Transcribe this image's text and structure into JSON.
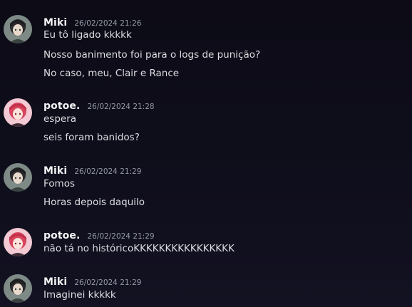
{
  "channel": {
    "messages": [
      {
        "author": "Miki",
        "avatar": "miki-avatar",
        "timestamp": "26/02/2024 21:26",
        "lines": [
          "Eu tô ligado kkkkk",
          "Nosso banimento foi para o logs de punição?",
          "No caso, meu, Clair e Rance"
        ]
      },
      {
        "author": "potoe.",
        "avatar": "potoe-avatar",
        "timestamp": "26/02/2024 21:28",
        "lines": [
          "espera",
          "seis foram banidos?"
        ]
      },
      {
        "author": "Miki",
        "avatar": "miki-avatar",
        "timestamp": "26/02/2024 21:29",
        "lines": [
          "Fomos",
          "Horas depois daquilo"
        ]
      },
      {
        "author": "potoe.",
        "avatar": "potoe-avatar",
        "timestamp": "26/02/2024 21:29",
        "lines": [
          "não tá no históricoKKKKKKKKKKKKKKKK"
        ]
      },
      {
        "author": "Miki",
        "avatar": "miki-avatar",
        "timestamp": "26/02/2024 21:29",
        "lines": [
          "Imaginei kkkkk"
        ]
      }
    ]
  },
  "colors": {
    "background": "#0e0d18",
    "username": "#f2f3f5",
    "timestamp": "#949ba4",
    "message_text": "#dbdee1"
  }
}
